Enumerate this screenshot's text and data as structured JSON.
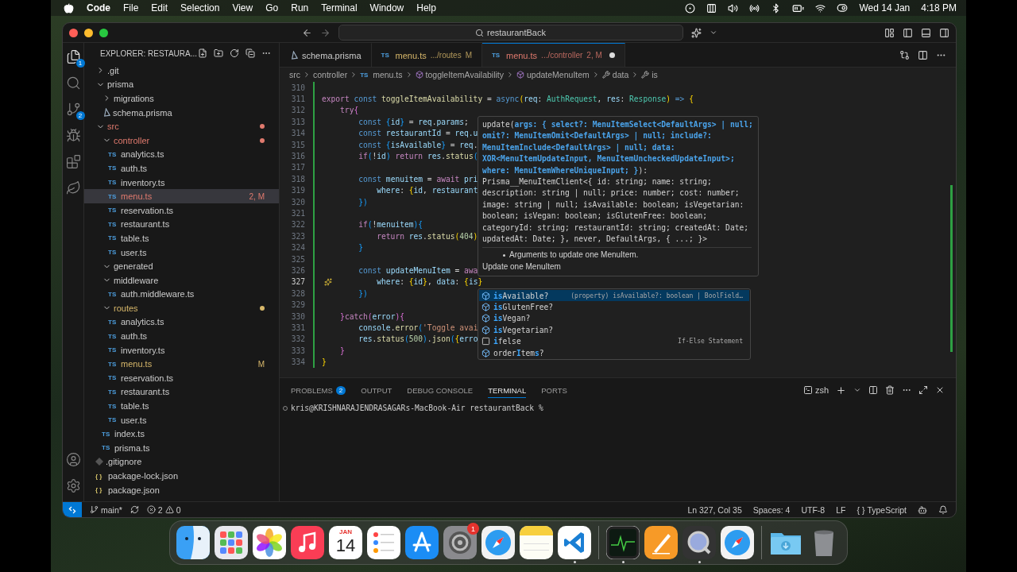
{
  "menubar": {
    "app": "Code",
    "items": [
      "File",
      "Edit",
      "Selection",
      "View",
      "Go",
      "Run",
      "Terminal",
      "Window",
      "Help"
    ],
    "date": "Wed 14 Jan",
    "time": "4:18 PM"
  },
  "window": {
    "search": "restaurantBack"
  },
  "activity_bar": [
    {
      "kind": "explorer",
      "selected": true,
      "badge": "1"
    },
    {
      "kind": "search",
      "selected": false
    },
    {
      "kind": "source-control",
      "selected": false,
      "badge": "2"
    },
    {
      "kind": "run",
      "selected": false
    },
    {
      "kind": "extensions",
      "selected": false
    },
    {
      "kind": "leaf",
      "selected": false
    }
  ],
  "activity_bottom": [
    {
      "kind": "account"
    },
    {
      "kind": "settings"
    }
  ],
  "sidebar": {
    "title": "EXPLORER: RESTAURA...",
    "tree": [
      {
        "label": ".git",
        "kind": "folder",
        "expanded": false,
        "selected": false
      },
      {
        "label": "prisma",
        "kind": "folder",
        "expanded": true,
        "selected": false,
        "children": [
          {
            "label": "migrations",
            "kind": "folder",
            "expanded": false,
            "selected": false
          },
          {
            "label": "schema.prisma",
            "kind": "prisma",
            "selected": false
          }
        ]
      },
      {
        "label": "src",
        "kind": "folder",
        "expanded": true,
        "selected": false,
        "color": "#e07a6e",
        "children": [
          {
            "label": "controller",
            "kind": "folder",
            "expanded": true,
            "selected": false,
            "color": "#e07a6e",
            "children": [
              {
                "label": "analytics.ts",
                "kind": "ts",
                "icon": "TS",
                "selected": false
              },
              {
                "label": "auth.ts",
                "kind": "ts",
                "icon": "TS",
                "selected": false
              },
              {
                "label": "inventory.ts",
                "kind": "ts",
                "icon": "TS",
                "selected": false
              },
              {
                "label": "menu.ts",
                "kind": "ts",
                "icon": "TS",
                "selected": true,
                "color": "#e07a6e",
                "badge": "2, M"
              },
              {
                "label": "reservation.ts",
                "kind": "ts",
                "icon": "TS",
                "selected": false
              },
              {
                "label": "restaurant.ts",
                "kind": "ts",
                "icon": "TS",
                "selected": false
              },
              {
                "label": "table.ts",
                "kind": "ts",
                "icon": "TS",
                "selected": false
              },
              {
                "label": "user.ts",
                "kind": "ts",
                "icon": "TS",
                "selected": false
              }
            ]
          },
          {
            "label": "generated",
            "kind": "folder",
            "expanded": true,
            "selected": false
          },
          {
            "label": "middleware",
            "kind": "folder",
            "expanded": true,
            "selected": false,
            "children": [
              {
                "label": "auth.middleware.ts",
                "kind": "ts",
                "icon": "TS",
                "selected": false
              }
            ]
          },
          {
            "label": "routes",
            "kind": "folder",
            "expanded": true,
            "selected": false,
            "color": "#d7b76a",
            "children": [
              {
                "label": "analytics.ts",
                "kind": "ts",
                "icon": "TS",
                "selected": false
              },
              {
                "label": "auth.ts",
                "kind": "ts",
                "icon": "TS",
                "selected": false
              },
              {
                "label": "inventory.ts",
                "kind": "ts",
                "icon": "TS",
                "selected": false
              },
              {
                "label": "menu.ts",
                "kind": "ts",
                "icon": "TS",
                "selected": false,
                "color": "#d7b76a",
                "badge": "M"
              },
              {
                "label": "reservation.ts",
                "kind": "ts",
                "icon": "TS",
                "selected": false
              },
              {
                "label": "restaurant.ts",
                "kind": "ts",
                "icon": "TS",
                "selected": false
              },
              {
                "label": "table.ts",
                "kind": "ts",
                "icon": "TS",
                "selected": false
              },
              {
                "label": "user.ts",
                "kind": "ts",
                "icon": "TS",
                "selected": false
              }
            ]
          },
          {
            "label": "index.ts",
            "kind": "ts",
            "icon": "TS",
            "selected": false
          },
          {
            "label": "prisma.ts",
            "kind": "ts",
            "icon": "TS",
            "selected": false
          }
        ]
      },
      {
        "label": ".gitignore",
        "kind": "git",
        "selected": false
      },
      {
        "label": "package-lock.json",
        "kind": "json",
        "icon": "{ }",
        "selected": false
      },
      {
        "label": "package.json",
        "kind": "json",
        "icon": "{ }",
        "selected": false
      }
    ]
  },
  "tabs": [
    {
      "kind": "prisma",
      "label": "schema.prisma",
      "selected": false,
      "dirty": false
    },
    {
      "kind": "ts",
      "icon": "TS",
      "label": "menu.ts",
      "path": ".../routes",
      "badge": "M",
      "color": "#d7b76a",
      "selected": false,
      "dirty": false
    },
    {
      "kind": "ts",
      "icon": "TS",
      "label": "menu.ts",
      "path": ".../controller",
      "badge": "2, M",
      "color": "#e07a6e",
      "selected": true,
      "dirty": true
    }
  ],
  "breadcrumbs": [
    {
      "label": "src",
      "kind": "folder"
    },
    {
      "label": "controller",
      "kind": "folder"
    },
    {
      "label": "menu.ts",
      "kind": "file",
      "icon": "TS"
    },
    {
      "label": "toggleItemAvailability",
      "kind": "function"
    },
    {
      "label": "updateMenuItem",
      "kind": "function"
    },
    {
      "label": "data",
      "kind": "property"
    },
    {
      "label": "is",
      "kind": "property"
    }
  ],
  "editor": {
    "lines": [
      {
        "n": "310",
        "changed": true,
        "current": false
      },
      {
        "n": "311",
        "changed": true,
        "current": false,
        "tokens": [
          {
            "t": "export ",
            "kind": "control"
          },
          {
            "t": "const ",
            "kind": "keyword"
          },
          {
            "t": "toggleItemAvailability",
            "kind": "function"
          },
          {
            "t": " = ",
            "kind": "plain"
          },
          {
            "t": "async",
            "kind": "keyword"
          },
          {
            "t": "(",
            "kind": "bracket"
          },
          {
            "t": "req",
            "kind": "variable"
          },
          {
            "t": ": ",
            "kind": "plain"
          },
          {
            "t": "AuthRequest",
            "kind": "type"
          },
          {
            "t": ", ",
            "kind": "plain"
          },
          {
            "t": "res",
            "kind": "variable"
          },
          {
            "t": ": ",
            "kind": "plain"
          },
          {
            "t": "Response",
            "kind": "type"
          },
          {
            "t": ")",
            "kind": "bracket"
          },
          {
            "t": " => ",
            "kind": "keyword"
          },
          {
            "t": "{",
            "kind": "bracket"
          }
        ]
      },
      {
        "n": "312",
        "changed": true,
        "current": false,
        "tokens": [
          {
            "t": "    try",
            "kind": "control"
          },
          {
            "t": "{",
            "kind": "bracket2"
          }
        ]
      },
      {
        "n": "313",
        "changed": true,
        "current": false,
        "tokens": [
          {
            "t": "        const ",
            "kind": "keyword"
          },
          {
            "t": "{",
            "kind": "bracket3"
          },
          {
            "t": "id",
            "kind": "variable"
          },
          {
            "t": "}",
            "kind": "bracket3"
          },
          {
            "t": " = ",
            "kind": "plain"
          },
          {
            "t": "req",
            "kind": "variable"
          },
          {
            "t": ".",
            "kind": "plain"
          },
          {
            "t": "params",
            "kind": "variable"
          },
          {
            "t": ";",
            "kind": "plain"
          }
        ]
      },
      {
        "n": "314",
        "changed": true,
        "current": false,
        "tokens": [
          {
            "t": "        const ",
            "kind": "keyword"
          },
          {
            "t": "restaurantId",
            "kind": "variable"
          },
          {
            "t": " = ",
            "kind": "plain"
          },
          {
            "t": "req",
            "kind": "variable"
          },
          {
            "t": ".u",
            "kind": "variable"
          }
        ]
      },
      {
        "n": "315",
        "changed": true,
        "current": false,
        "tokens": [
          {
            "t": "        const ",
            "kind": "keyword"
          },
          {
            "t": "{",
            "kind": "bracket3"
          },
          {
            "t": "isAvailable",
            "kind": "variable"
          },
          {
            "t": "}",
            "kind": "bracket3"
          },
          {
            "t": " = ",
            "kind": "plain"
          },
          {
            "t": "req",
            "kind": "variable"
          },
          {
            "t": ".",
            "kind": "plain"
          }
        ]
      },
      {
        "n": "316",
        "changed": true,
        "current": false,
        "tokens": [
          {
            "t": "        if",
            "kind": "control"
          },
          {
            "t": "(",
            "kind": "bracket3"
          },
          {
            "t": "!",
            "kind": "plain"
          },
          {
            "t": "id",
            "kind": "variable"
          },
          {
            "t": ")",
            "kind": "bracket3"
          },
          {
            "t": " return ",
            "kind": "control"
          },
          {
            "t": "res",
            "kind": "variable"
          },
          {
            "t": ".",
            "kind": "plain"
          },
          {
            "t": "status",
            "kind": "function"
          },
          {
            "t": "(",
            "kind": "bracket3"
          }
        ]
      },
      {
        "n": "317",
        "changed": true,
        "current": false
      },
      {
        "n": "318",
        "changed": true,
        "current": false,
        "tokens": [
          {
            "t": "        const ",
            "kind": "keyword"
          },
          {
            "t": "menuitem",
            "kind": "variable"
          },
          {
            "t": " = ",
            "kind": "plain"
          },
          {
            "t": "await ",
            "kind": "control"
          },
          {
            "t": "pri",
            "kind": "variable"
          }
        ]
      },
      {
        "n": "319",
        "changed": true,
        "current": false,
        "tokens": [
          {
            "t": "            where",
            "kind": "variable"
          },
          {
            "t": ": ",
            "kind": "plain"
          },
          {
            "t": "{",
            "kind": "bracket"
          },
          {
            "t": "id",
            "kind": "variable"
          },
          {
            "t": ", ",
            "kind": "plain"
          },
          {
            "t": "restaurant",
            "kind": "variable"
          }
        ]
      },
      {
        "n": "320",
        "changed": true,
        "current": false,
        "tokens": [
          {
            "t": "        }",
            "kind": "bracket3"
          },
          {
            "t": ")",
            "kind": "bracket3"
          }
        ]
      },
      {
        "n": "321",
        "changed": true,
        "current": false
      },
      {
        "n": "322",
        "changed": true,
        "current": false,
        "tokens": [
          {
            "t": "        if",
            "kind": "control"
          },
          {
            "t": "(",
            "kind": "bracket3"
          },
          {
            "t": "!",
            "kind": "plain"
          },
          {
            "t": "menuitem",
            "kind": "variable"
          },
          {
            "t": ")",
            "kind": "bracket3"
          },
          {
            "t": "{",
            "kind": "bracket3"
          }
        ]
      },
      {
        "n": "323",
        "changed": true,
        "current": false,
        "tokens": [
          {
            "t": "            return ",
            "kind": "control"
          },
          {
            "t": "res",
            "kind": "variable"
          },
          {
            "t": ".",
            "kind": "plain"
          },
          {
            "t": "status",
            "kind": "function"
          },
          {
            "t": "(",
            "kind": "bracket"
          },
          {
            "t": "404",
            "kind": "number"
          },
          {
            "t": ")",
            "kind": "bracket"
          }
        ]
      },
      {
        "n": "324",
        "changed": true,
        "current": false,
        "tokens": [
          {
            "t": "        }",
            "kind": "bracket3"
          }
        ]
      },
      {
        "n": "325",
        "changed": true,
        "current": false
      },
      {
        "n": "326",
        "changed": true,
        "current": false,
        "tokens": [
          {
            "t": "        const ",
            "kind": "keyword"
          },
          {
            "t": "updateMenuItem",
            "kind": "variable"
          },
          {
            "t": " = ",
            "kind": "plain"
          },
          {
            "t": "awa",
            "kind": "control"
          }
        ]
      },
      {
        "n": "327",
        "changed": true,
        "current": true,
        "tokens": [
          {
            "t": "            where",
            "kind": "variable"
          },
          {
            "t": ": ",
            "kind": "plain"
          },
          {
            "t": "{",
            "kind": "bracket"
          },
          {
            "t": "id",
            "kind": "variable"
          },
          {
            "t": "}",
            "kind": "bracket"
          },
          {
            "t": ", ",
            "kind": "plain"
          },
          {
            "t": "data",
            "kind": "variable"
          },
          {
            "t": ": ",
            "kind": "plain"
          },
          {
            "t": "{",
            "kind": "bracket"
          },
          {
            "t": "is",
            "kind": "variable"
          },
          {
            "t": "}",
            "kind": "bracket"
          }
        ]
      },
      {
        "n": "328",
        "changed": true,
        "current": false,
        "tokens": [
          {
            "t": "        }",
            "kind": "bracket3"
          },
          {
            "t": ")",
            "kind": "bracket3"
          }
        ]
      },
      {
        "n": "329",
        "changed": true,
        "current": false
      },
      {
        "n": "330",
        "changed": true,
        "current": false,
        "tokens": [
          {
            "t": "    }",
            "kind": "bracket2"
          },
          {
            "t": "catch",
            "kind": "control"
          },
          {
            "t": "(",
            "kind": "bracket2"
          },
          {
            "t": "error",
            "kind": "variable"
          },
          {
            "t": ")",
            "kind": "bracket2"
          },
          {
            "t": "{",
            "kind": "bracket2"
          }
        ]
      },
      {
        "n": "331",
        "changed": true,
        "current": false,
        "tokens": [
          {
            "t": "        console",
            "kind": "variable"
          },
          {
            "t": ".",
            "kind": "plain"
          },
          {
            "t": "error",
            "kind": "function"
          },
          {
            "t": "(",
            "kind": "bracket3"
          },
          {
            "t": "'Toggle avai",
            "kind": "string"
          }
        ]
      },
      {
        "n": "332",
        "changed": true,
        "current": false,
        "tokens": [
          {
            "t": "        res",
            "kind": "variable"
          },
          {
            "t": ".",
            "kind": "plain"
          },
          {
            "t": "status",
            "kind": "function"
          },
          {
            "t": "(",
            "kind": "bracket3"
          },
          {
            "t": "500",
            "kind": "number"
          },
          {
            "t": ")",
            "kind": "bracket3"
          },
          {
            "t": ".",
            "kind": "plain"
          },
          {
            "t": "json",
            "kind": "function"
          },
          {
            "t": "(",
            "kind": "bracket3"
          },
          {
            "t": "{",
            "kind": "bracket"
          },
          {
            "t": "erro",
            "kind": "variable"
          }
        ]
      },
      {
        "n": "333",
        "changed": true,
        "current": false,
        "tokens": [
          {
            "t": "    }",
            "kind": "bracket2"
          }
        ]
      },
      {
        "n": "334",
        "changed": true,
        "current": false,
        "tokens": [
          {
            "t": "}",
            "kind": "bracket"
          }
        ]
      }
    ]
  },
  "hover": {
    "signature": [
      [
        {
          "t": "update(",
          "kind": "plain"
        },
        {
          "t": "args: { select?: MenuItemSelect<DefaultArgs> | null;",
          "kind": "param"
        }
      ],
      [
        {
          "t": "omit?: MenuItemOmit<DefaultArgs> | null; include?:",
          "kind": "param"
        }
      ],
      [
        {
          "t": "MenuItemInclude<DefaultArgs> | null; data:",
          "kind": "param"
        }
      ],
      [
        {
          "t": "XOR<MenuItemUpdateInput, MenuItemUncheckedUpdateInput>;",
          "kind": "param"
        }
      ],
      [
        {
          "t": "where: MenuItemWhereUniqueInput; }",
          "kind": "param"
        },
        {
          "t": "):",
          "kind": "plain"
        }
      ],
      [
        {
          "t": "Prisma__MenuItemClient<{ id: string; name: string;",
          "kind": "plain"
        }
      ],
      [
        {
          "t": "description: string | null; price: number; cost: number;",
          "kind": "plain"
        }
      ],
      [
        {
          "t": "image: string | null; isAvailable: boolean; isVegetarian:",
          "kind": "plain"
        }
      ],
      [
        {
          "t": "boolean; isVegan: boolean; isGlutenFree: boolean;",
          "kind": "plain"
        }
      ],
      [
        {
          "t": "categoryId: string; restaurantId: string; createdAt: Date;",
          "kind": "plain"
        }
      ],
      [
        {
          "t": "updatedAt: Date; }, never, DefaultArgs, { ...; }>",
          "kind": "plain"
        }
      ]
    ],
    "bullet": "Arguments to update one MenuItem.",
    "note": "Update one MenuItem"
  },
  "suggest": [
    {
      "kind": "property",
      "parts": [
        {
          "t": "is",
          "match": true
        },
        {
          "t": "Available?",
          "match": false
        }
      ],
      "detail": "(property) isAvailable?: boolean | BoolField…",
      "selected": true
    },
    {
      "kind": "property",
      "parts": [
        {
          "t": "is",
          "match": true
        },
        {
          "t": "GlutenFree?",
          "match": false
        }
      ],
      "selected": false
    },
    {
      "kind": "property",
      "parts": [
        {
          "t": "is",
          "match": true
        },
        {
          "t": "Vegan?",
          "match": false
        }
      ],
      "selected": false
    },
    {
      "kind": "property",
      "parts": [
        {
          "t": "is",
          "match": true
        },
        {
          "t": "Vegetarian?",
          "match": false
        }
      ],
      "selected": false
    },
    {
      "kind": "snippet",
      "parts": [
        {
          "t": "i",
          "match": true
        },
        {
          "t": "felse",
          "match": false
        }
      ],
      "detail": "If-Else Statement",
      "selected": false
    },
    {
      "kind": "property",
      "parts": [
        {
          "t": "order",
          "match": false
        },
        {
          "t": "I",
          "match": true
        },
        {
          "t": "tem",
          "match": false
        },
        {
          "t": "s",
          "match": true
        },
        {
          "t": "?",
          "match": false
        }
      ],
      "selected": false
    }
  ],
  "panel": {
    "tabs": [
      {
        "label": "PROBLEMS",
        "count": "2",
        "selected": false
      },
      {
        "label": "OUTPUT",
        "selected": false
      },
      {
        "label": "DEBUG CONSOLE",
        "selected": false
      },
      {
        "label": "TERMINAL",
        "selected": true
      },
      {
        "label": "PORTS",
        "selected": false
      }
    ],
    "shell": "zsh",
    "terminal_lines": [
      "kris@KRISHNARAJENDRASAGARs-MacBook-Air restaurantBack %"
    ]
  },
  "status_bar": {
    "branch": "main*",
    "errors": "2",
    "warnings": "0",
    "right": [
      {
        "label": "Ln 327, Col 35"
      },
      {
        "label": "Spaces: 4"
      },
      {
        "label": "UTF-8"
      },
      {
        "label": "LF"
      },
      {
        "label": "TypeScript",
        "icon": "{ }"
      }
    ]
  },
  "dock": [
    {
      "kind": "finder",
      "running": false
    },
    {
      "kind": "launchpad",
      "running": false
    },
    {
      "kind": "photos",
      "running": false
    },
    {
      "kind": "music",
      "running": false
    },
    {
      "kind": "calendar",
      "month": "JAN",
      "day": "14",
      "running": false
    },
    {
      "kind": "reminders",
      "running": false
    },
    {
      "kind": "appstore",
      "running": false
    },
    {
      "kind": "settings",
      "badge": "1",
      "running": false
    },
    {
      "kind": "safari",
      "running": false
    },
    {
      "kind": "notes",
      "running": false
    },
    {
      "kind": "vscode",
      "running": true
    },
    {
      "kind": "separator"
    },
    {
      "kind": "activity",
      "running": true
    },
    {
      "kind": "pages",
      "running": false
    },
    {
      "kind": "quicktime",
      "running": true
    },
    {
      "kind": "safari",
      "running": false
    },
    {
      "kind": "separator"
    },
    {
      "kind": "downloads",
      "running": false
    },
    {
      "kind": "trash",
      "running": false
    }
  ]
}
